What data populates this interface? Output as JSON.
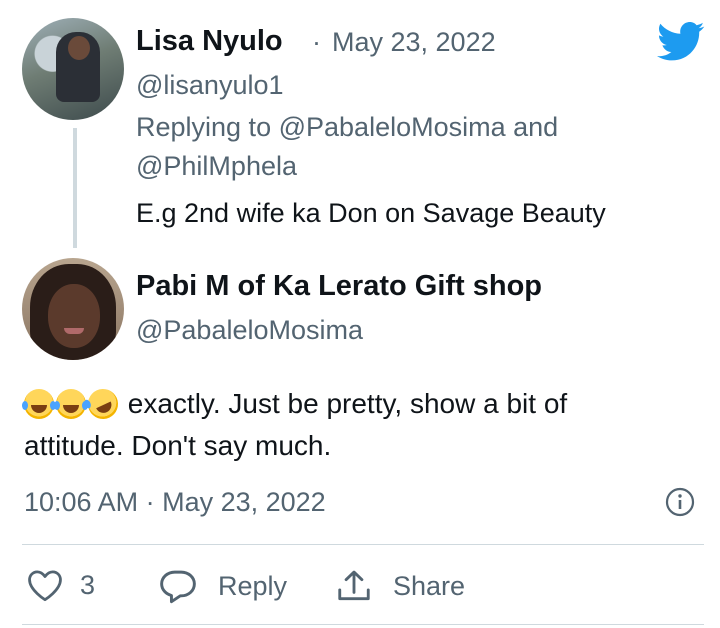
{
  "reply_tweet": {
    "author_name": "Lisa Nyulo",
    "separator": "·",
    "date": "May 23, 2022",
    "handle": "@lisanyulo1",
    "replying_to_prefix": "Replying to",
    "replying_to_user1": "@PabaleloMosima",
    "replying_to_and": "and",
    "replying_to_user2": "@PhilMphela",
    "text": "E.g 2nd wife ka Don on Savage Beauty"
  },
  "main_tweet": {
    "author_name": "Pabi M of Ka Lerato Gift shop",
    "handle": "@PabaleloMosima",
    "emojis": [
      "face-with-tears-of-joy",
      "face-with-tears-of-joy",
      "rolling-on-the-floor-laughing"
    ],
    "text_line1": "exactly. Just be pretty, show a bit of",
    "text_line2": "attitude. Don't say much.",
    "timestamp": "10:06 AM · May 23, 2022"
  },
  "actions": {
    "like_count": "3",
    "reply_label": "Reply",
    "share_label": "Share"
  },
  "colors": {
    "twitter_blue": "#1d9bf0",
    "text_primary": "#0f1419",
    "text_secondary": "#536471",
    "divider": "#cfd9de"
  },
  "icons": [
    "twitter-bird-icon",
    "info-icon",
    "heart-icon",
    "reply-bubble-icon",
    "share-icon"
  ]
}
